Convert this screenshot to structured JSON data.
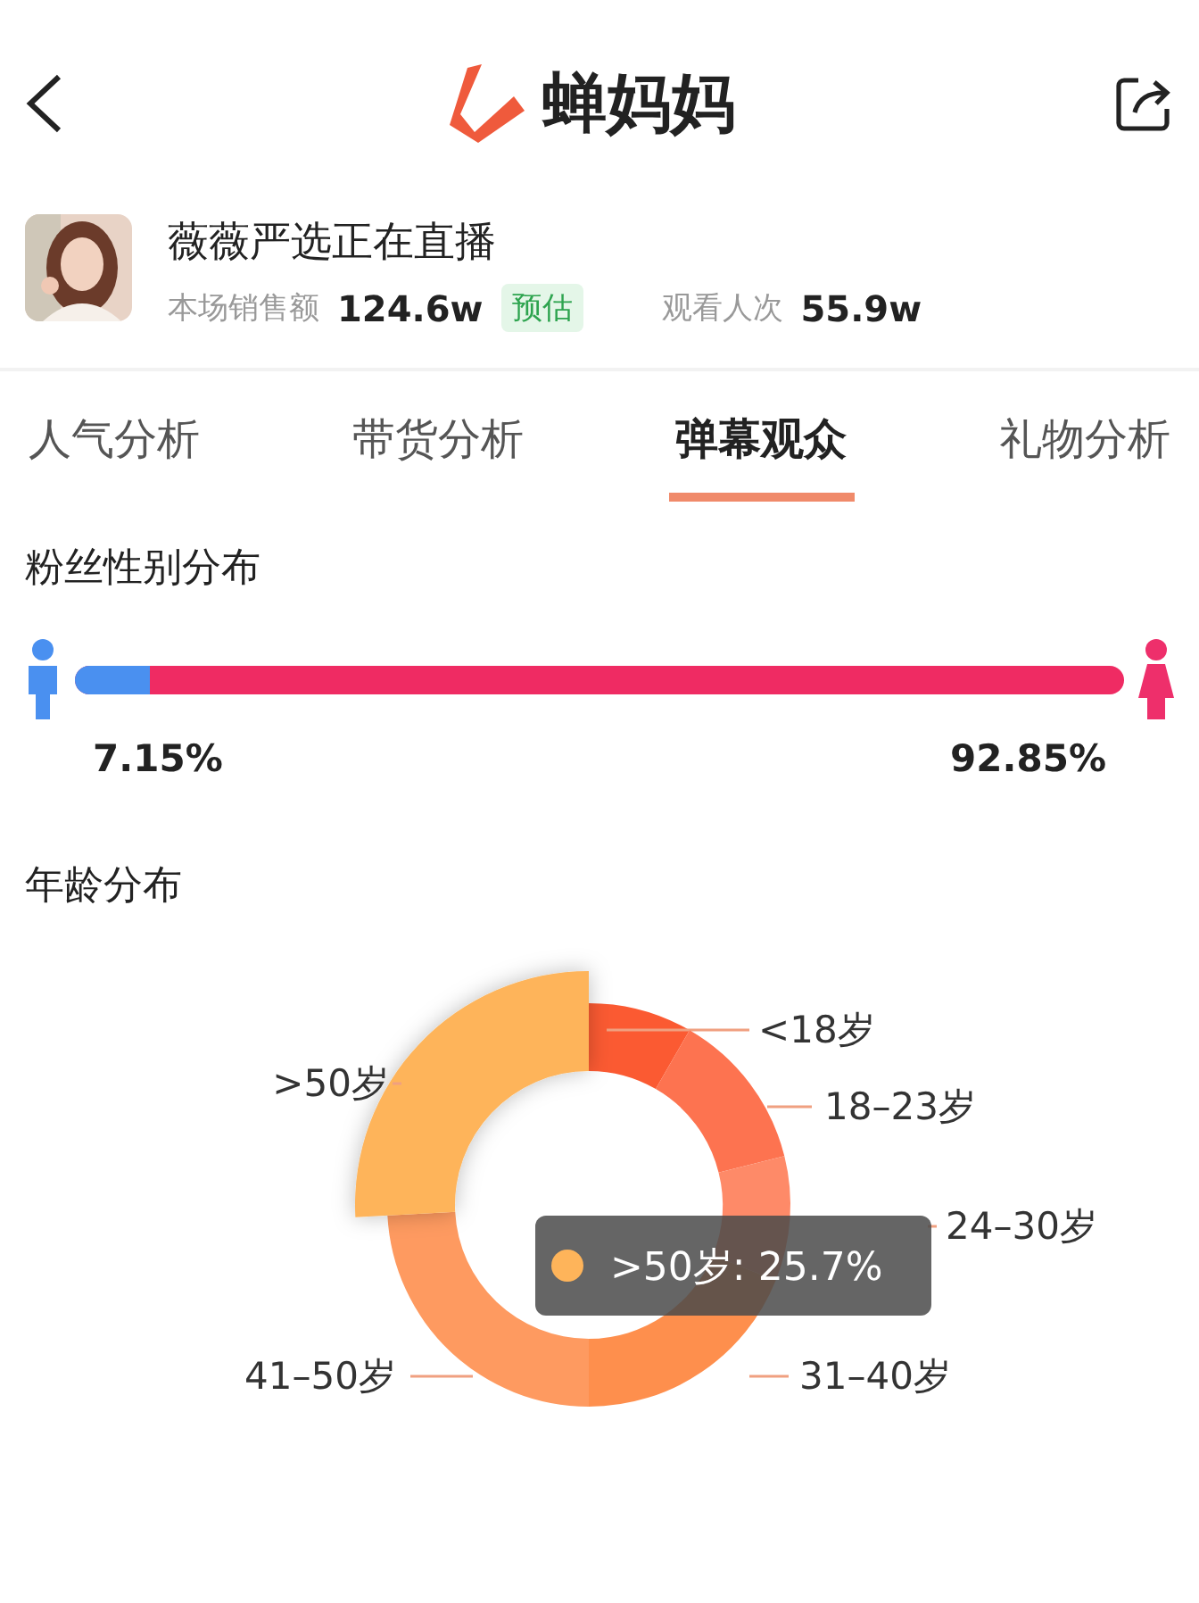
{
  "header": {
    "title": "蝉妈妈"
  },
  "live": {
    "name": "薇薇严选正在直播",
    "sales_label": "本场销售额",
    "sales_value": "124.6w",
    "estimate_badge": "预估",
    "views_label": "观看人次",
    "views_value": "55.9w"
  },
  "tabs": [
    {
      "label": "人气分析",
      "selected": false
    },
    {
      "label": "带货分析",
      "selected": false
    },
    {
      "label": "弹幕观众",
      "selected": true
    },
    {
      "label": "礼物分析",
      "selected": false
    }
  ],
  "gender": {
    "title": "粉丝性别分布",
    "male_percent": "7.15%",
    "female_percent": "92.85%",
    "level": 0.0715
  },
  "age": {
    "title": "年龄分布",
    "segments": [
      {
        "label": "<18岁",
        "color": "#fb5a32",
        "highlighted": false
      },
      {
        "label": "18–23岁",
        "color": "#fd7350",
        "highlighted": false
      },
      {
        "label": "24–30岁",
        "color": "#fe8a68",
        "highlighted": false
      },
      {
        "label": "31–40岁",
        "color": "#fe8f4d",
        "highlighted": false
      },
      {
        "label": "41–50岁",
        "color": "#fe9a60",
        "highlighted": false
      },
      {
        "label": ">50岁",
        "color": "#feb45a",
        "highlighted": true
      }
    ],
    "tooltip": ">50岁: 25.7%"
  }
}
